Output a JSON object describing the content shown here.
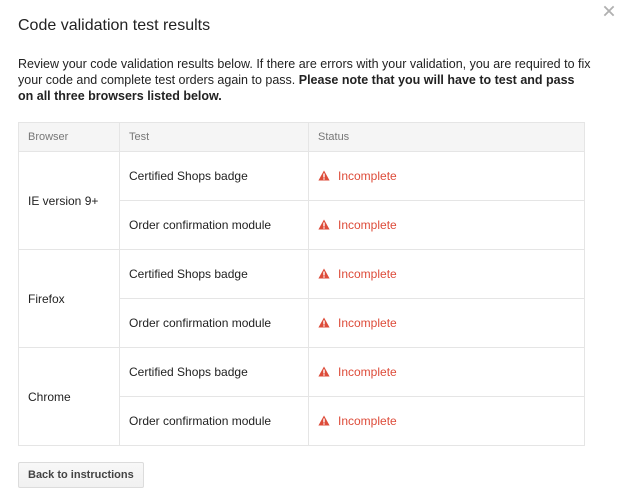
{
  "dialog": {
    "title": "Code validation test results",
    "description_plain": "Review your code validation results below. If there are errors with your validation, you are required to fix your code and complete test orders again to pass.",
    "description_bold": "Please note that you will have to test and pass on all three browsers listed below."
  },
  "table": {
    "headers": [
      "Browser",
      "Test",
      "Status"
    ],
    "rows": [
      {
        "browser": "IE version 9+",
        "tests": [
          {
            "test": "Certified Shops badge",
            "status": "Incomplete"
          },
          {
            "test": "Order confirmation module",
            "status": "Incomplete"
          }
        ]
      },
      {
        "browser": "Firefox",
        "tests": [
          {
            "test": "Certified Shops badge",
            "status": "Incomplete"
          },
          {
            "test": "Order confirmation module",
            "status": "Incomplete"
          }
        ]
      },
      {
        "browser": "Chrome",
        "tests": [
          {
            "test": "Certified Shops badge",
            "status": "Incomplete"
          },
          {
            "test": "Order confirmation module",
            "status": "Incomplete"
          }
        ]
      }
    ]
  },
  "actions": {
    "back_label": "Back to instructions"
  },
  "icons": {
    "close": "close-icon",
    "status": "warning-icon"
  },
  "colors": {
    "status_error": "#dd4b39",
    "header_bg": "#f5f5f5",
    "border": "#e5e5e5"
  }
}
